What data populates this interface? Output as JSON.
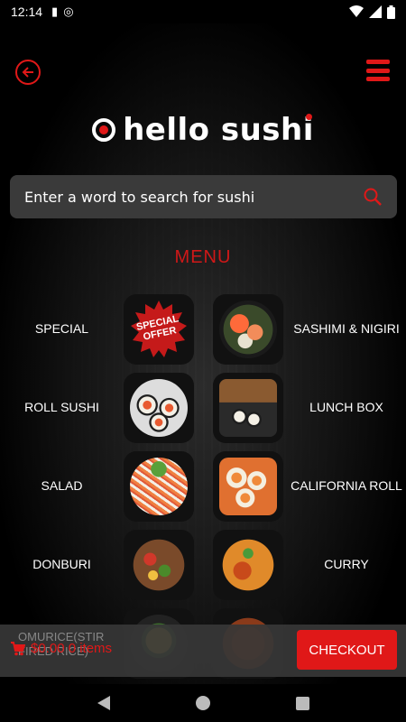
{
  "status_bar": {
    "time": "12:14"
  },
  "header": {
    "logo_text": "hello sushi"
  },
  "search": {
    "placeholder": "Enter a word to search for sushi"
  },
  "menu": {
    "title": "MENU",
    "special_badge": "SPECIAL OFFER",
    "items": [
      {
        "label": "SPECIAL"
      },
      {
        "label": "SASHIMI & NIGIRI"
      },
      {
        "label": "ROLL SUSHI"
      },
      {
        "label": "LUNCH BOX"
      },
      {
        "label": "SALAD"
      },
      {
        "label": "CALIFORNIA ROLL"
      },
      {
        "label": "DONBURI"
      },
      {
        "label": "CURRY"
      },
      {
        "label": "OMURICE(STIR FIRED RICE)"
      }
    ]
  },
  "cart": {
    "summary": "$0.00 0 items",
    "checkout_label": "CHECKOUT"
  },
  "colors": {
    "accent": "#e01818",
    "search_bg": "#3a3a3a",
    "bottom_bar": "#373737"
  }
}
